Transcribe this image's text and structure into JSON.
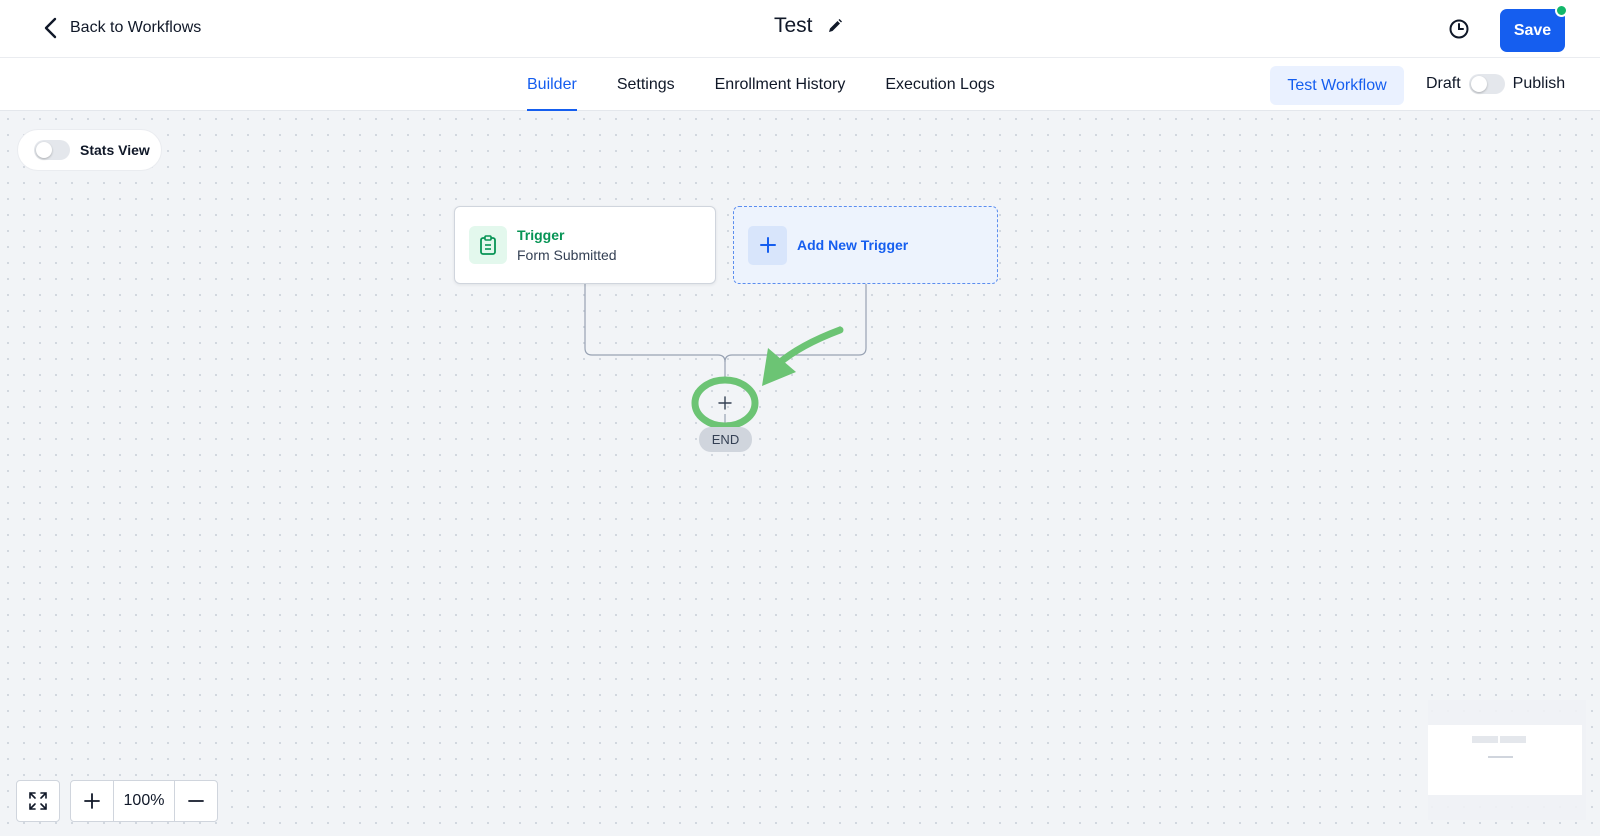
{
  "header": {
    "back_label": "Back to Workflows",
    "title": "Test",
    "save_label": "Save",
    "save_status_color": "#12b76a",
    "icons": {
      "back": "chevron-left-icon",
      "edit": "pencil-icon",
      "history": "history-icon"
    }
  },
  "tabs": [
    {
      "label": "Builder",
      "active": true
    },
    {
      "label": "Settings",
      "active": false
    },
    {
      "label": "Enrollment History",
      "active": false
    },
    {
      "label": "Execution Logs",
      "active": false
    }
  ],
  "actions": {
    "test_workflow_label": "Test Workflow",
    "draft_label": "Draft",
    "publish_label": "Publish",
    "publish_toggle_on": false
  },
  "canvas": {
    "stats_view_label": "Stats View",
    "stats_view_on": false,
    "trigger": {
      "title": "Trigger",
      "subtitle": "Form Submitted",
      "icon": "clipboard-icon"
    },
    "add_trigger": {
      "label": "Add New Trigger",
      "icon": "plus-icon"
    },
    "add_step_icon": "plus-icon",
    "end_label": "END",
    "annotation_color": "#6cc474"
  },
  "zoom": {
    "level": "100%",
    "icons": [
      "fullscreen-icon",
      "plus-icon",
      "minus-icon"
    ]
  },
  "colors": {
    "accent": "#155eef",
    "trigger_green": "#079455"
  }
}
